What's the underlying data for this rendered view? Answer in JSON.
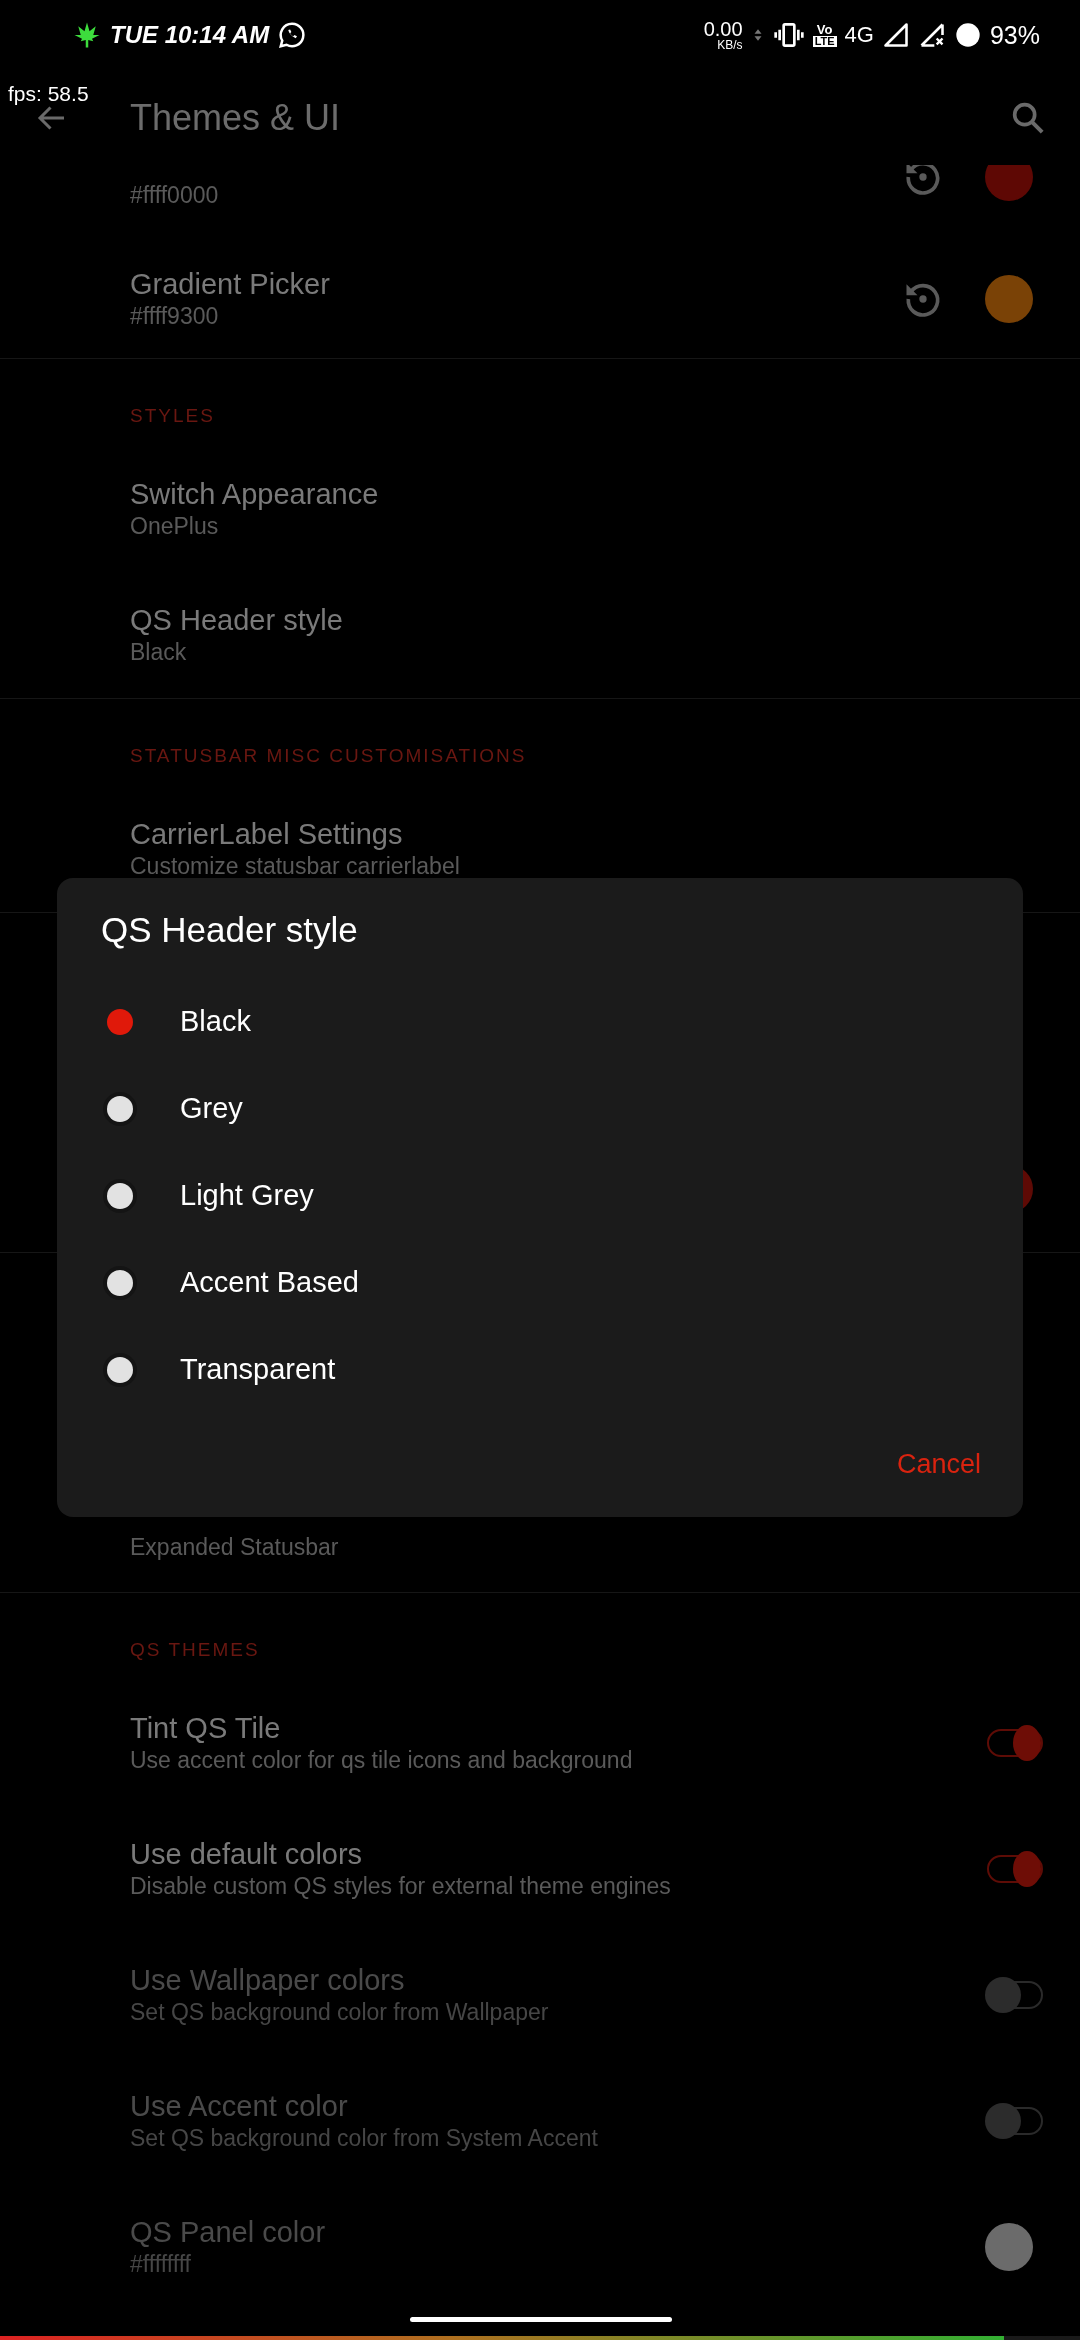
{
  "status_bar": {
    "time": "TUE 10:14 AM",
    "net_speed": "0.00",
    "net_unit": "KB/s",
    "volte_top": "Vo",
    "volte_bottom": "LTE",
    "network": "4G",
    "battery": "93%",
    "battery_bar": {
      "level": 0.93
    }
  },
  "fps_overlay": "fps: 58.5",
  "app_bar": {
    "title": "Themes & UI"
  },
  "sections": [
    {
      "items": [
        {
          "kind": "color",
          "subtitle": "#ffff0000",
          "reset": true,
          "color": "#5e0804",
          "disabled": false
        },
        {
          "kind": "color",
          "title": "Gradient Picker",
          "subtitle": "#ffff9300",
          "reset": true,
          "color": "#7a4206",
          "disabled": false
        }
      ]
    },
    {
      "header": "STYLES",
      "items": [
        {
          "kind": "setting",
          "title": "Switch Appearance",
          "subtitle": "OnePlus",
          "disabled": false
        },
        {
          "kind": "setting",
          "title": "QS Header style",
          "subtitle": "Black",
          "disabled": false
        }
      ]
    },
    {
      "header": "STATUSBAR MISC CUSTOMISATIONS",
      "items": [
        {
          "kind": "setting",
          "title": "CarrierLabel Settings",
          "subtitle": "Customize statusbar carrierlabel",
          "disabled": false
        }
      ]
    },
    {
      "items": [
        {
          "kind": "color",
          "reset": false,
          "color": "#5e0a05"
        }
      ]
    },
    {
      "items": [
        {
          "kind": "setting",
          "subtitle": "Expanded Statusbar",
          "disabled": false
        }
      ]
    },
    {
      "header": "QS THEMES",
      "items": [
        {
          "kind": "toggle",
          "title": "Tint QS Tile",
          "subtitle": "Use accent color for qs tile icons and background",
          "on": true,
          "disabled": false
        },
        {
          "kind": "toggle",
          "title": "Use default colors",
          "subtitle": "Disable custom QS styles for external theme engines",
          "on": true,
          "disabled": false
        },
        {
          "kind": "toggle",
          "title": "Use Wallpaper colors",
          "subtitle": "Set QS background color from Wallpaper",
          "on": false,
          "disabled": true
        },
        {
          "kind": "toggle",
          "title": "Use Accent color",
          "subtitle": "Set QS background color from System Accent",
          "on": false,
          "disabled": true
        },
        {
          "kind": "color",
          "title": "QS Panel color",
          "subtitle": "#ffffffff",
          "reset": false,
          "color": "#6b6b6b",
          "disabled": true
        }
      ]
    }
  ],
  "dialog": {
    "title": "QS Header style",
    "options": [
      {
        "label": "Black",
        "selected": true
      },
      {
        "label": "Grey",
        "selected": false
      },
      {
        "label": "Light Grey",
        "selected": false
      },
      {
        "label": "Accent Based",
        "selected": false
      },
      {
        "label": "Transparent",
        "selected": false
      }
    ],
    "cancel": "Cancel"
  }
}
